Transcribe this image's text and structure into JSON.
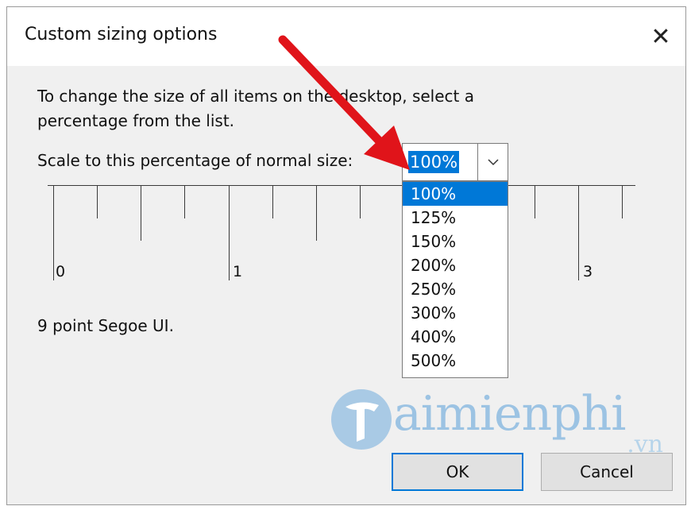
{
  "window": {
    "title": "Custom sizing options",
    "close_icon": "close-icon"
  },
  "description": "To change the size of all items on the desktop, select a percentage from the list.",
  "scale": {
    "label": "Scale to this percentage of normal size:",
    "selected": "100%",
    "options": [
      "100%",
      "125%",
      "150%",
      "200%",
      "250%",
      "300%",
      "400%",
      "500%"
    ],
    "dropdown_icon": "chevron-down-icon"
  },
  "ruler": {
    "labels": [
      "0",
      "1",
      "3"
    ]
  },
  "font_info": "9 point Segoe UI.",
  "buttons": {
    "ok": "OK",
    "cancel": "Cancel"
  },
  "watermark": {
    "text": "aimienphi",
    "suffix": ".vn"
  },
  "colors": {
    "selection": "#0078d7",
    "annotation_arrow": "#e0141a",
    "watermark": "#9cc3e3"
  }
}
